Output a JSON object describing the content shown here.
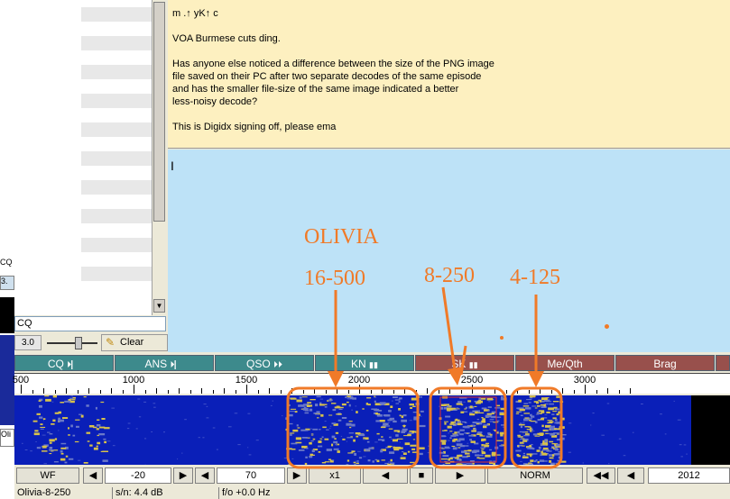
{
  "rx": {
    "lines": [
      "m          .↑ yK↑ c",
      "VOA Burmese cuts ding.",
      "Has anyone else noticed a difference between the size of the PNG image",
      "file saved on their PC after two separate decodes of the same episode",
      "and has the smaller file-size of the same image indicated a better",
      "less-noisy decode?",
      "This is Digidx signing off, please ema"
    ]
  },
  "tx": {
    "cursor": "I"
  },
  "left": {
    "cq1": "CQ",
    "val1": "3.",
    "olive": "Oli",
    "cq_field": "CQ",
    "squelch": "3.0",
    "clear": "Clear"
  },
  "macros": [
    "CQ",
    "ANS",
    "QSO",
    "KN",
    "SK",
    "Me/Qth",
    "Brag"
  ],
  "macro_icons": [
    "⏵▏",
    "⏵▏",
    "⏵⏵",
    "▮▮",
    "▮▮",
    "",
    ""
  ],
  "scale": {
    "labels": [
      "500",
      "1000",
      "1500",
      "2000",
      "2500",
      "3000"
    ]
  },
  "controls": {
    "wf": "WF",
    "ref": "-20",
    "range": "70",
    "speed": "x1",
    "norm": "NORM",
    "freq": "2012"
  },
  "status": {
    "mode": "Olivia-8-250",
    "sn": "s/n:  4.4 dB",
    "fo": "f/o +0.0 Hz"
  },
  "annotations": {
    "title": "OLIVIA",
    "m1": "16-500",
    "m2": "8-250",
    "m3": "4-125"
  },
  "colors": {
    "macro_green": "#3d8a8c",
    "macro_red": "#98504c",
    "annotation": "#f07a28",
    "rx_bg": "#fdf0c0",
    "tx_bg": "#bde2f7"
  }
}
